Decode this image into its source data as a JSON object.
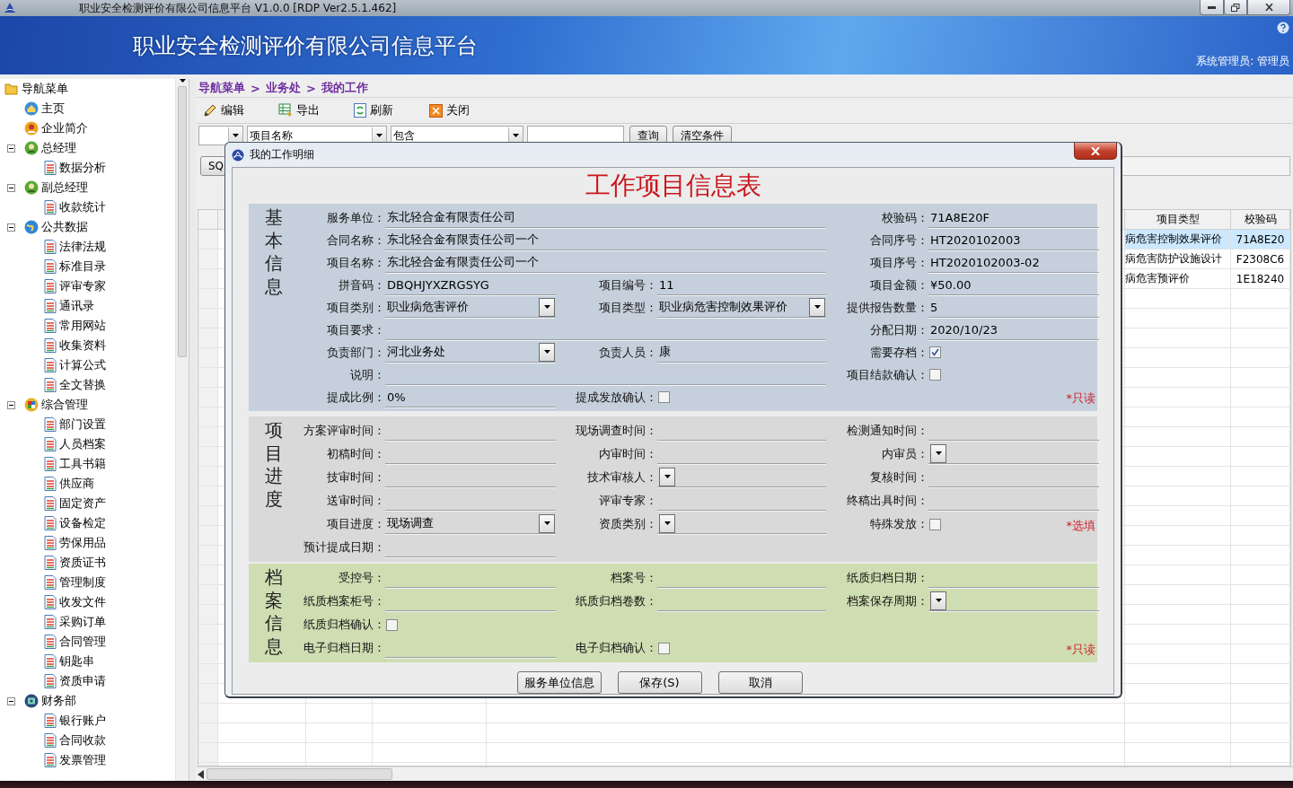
{
  "window": {
    "title": "职业安全检测评价有限公司信息平台 V1.0.0 [RDP Ver2.5.1.462]"
  },
  "banner": {
    "title": "职业安全检测评价有限公司信息平台",
    "user": "系统管理员: 管理员"
  },
  "sidebar": {
    "items": [
      {
        "label": "导航菜单",
        "kind": "folder",
        "children": [
          {
            "label": "主页",
            "kind": "home"
          },
          {
            "label": "企业简介",
            "kind": "contact"
          },
          {
            "label": "总经理",
            "kind": "manager",
            "expanded": true,
            "children": [
              {
                "label": "数据分析",
                "kind": "page"
              }
            ]
          },
          {
            "label": "副总经理",
            "kind": "manager",
            "expanded": true,
            "children": [
              {
                "label": "收款统计",
                "kind": "page"
              }
            ]
          },
          {
            "label": "公共数据",
            "kind": "globe",
            "expanded": true,
            "children": [
              {
                "label": "法律法规",
                "kind": "page"
              },
              {
                "label": "标准目录",
                "kind": "page"
              },
              {
                "label": "评审专家",
                "kind": "page"
              },
              {
                "label": "通讯录",
                "kind": "page"
              },
              {
                "label": "常用网站",
                "kind": "page"
              },
              {
                "label": "收集资料",
                "kind": "page"
              },
              {
                "label": "计算公式",
                "kind": "page"
              },
              {
                "label": "全文替换",
                "kind": "page"
              }
            ]
          },
          {
            "label": "综合管理",
            "kind": "admin",
            "expanded": true,
            "children": [
              {
                "label": "部门设置",
                "kind": "page"
              },
              {
                "label": "人员档案",
                "kind": "page"
              },
              {
                "label": "工具书籍",
                "kind": "page"
              },
              {
                "label": "供应商",
                "kind": "page"
              },
              {
                "label": "固定资产",
                "kind": "page"
              },
              {
                "label": "设备检定",
                "kind": "page"
              },
              {
                "label": "劳保用品",
                "kind": "page"
              },
              {
                "label": "资质证书",
                "kind": "page"
              },
              {
                "label": "管理制度",
                "kind": "page"
              },
              {
                "label": "收发文件",
                "kind": "page"
              },
              {
                "label": "采购订单",
                "kind": "page"
              },
              {
                "label": "合同管理",
                "kind": "page"
              },
              {
                "label": "钥匙串",
                "kind": "page"
              },
              {
                "label": "资质申请",
                "kind": "page"
              }
            ]
          },
          {
            "label": "财务部",
            "kind": "finance",
            "expanded": true,
            "children": [
              {
                "label": "银行账户",
                "kind": "page"
              },
              {
                "label": "合同收款",
                "kind": "page"
              },
              {
                "label": "发票管理",
                "kind": "page"
              }
            ]
          }
        ]
      }
    ]
  },
  "breadcrumb": {
    "items": [
      "导航菜单",
      "业务处",
      "我的工作"
    ],
    "separator": ">"
  },
  "toolbar": [
    {
      "label": "编辑",
      "kind": "edit"
    },
    {
      "label": "导出",
      "kind": "export"
    },
    {
      "label": "刷新",
      "kind": "refresh"
    },
    {
      "label": "关闭",
      "kind": "close"
    }
  ],
  "filter": {
    "field": "项目名称",
    "operator": "包含",
    "buttons": [
      "查询",
      "清空条件"
    ],
    "sql_button": "SQ"
  },
  "table": {
    "columns": [
      "项目类型",
      "校验码"
    ],
    "rows": [
      {
        "cells": [
          "病危害控制效果评价",
          "71A8E20"
        ],
        "selected": true
      },
      {
        "cells": [
          "病危害防护设施设计",
          "F2308C6"
        ],
        "selected": false
      },
      {
        "cells": [
          "病危害预评价",
          "1E18240"
        ],
        "selected": false
      }
    ]
  },
  "dialog": {
    "title": "我的工作明细",
    "heading": "工作项目信息表",
    "sections": [
      {
        "kind": "basic",
        "title": "基本信息",
        "rows": [
          {
            "fields": [
              {
                "label": "服务单位：",
                "kind": "text",
                "value": "东北轻合金有限责任公司",
                "wide": true
              },
              {
                "label": "校验码：",
                "kind": "text",
                "value": "71A8E20F"
              }
            ]
          },
          {
            "fields": [
              {
                "label": "合同名称：",
                "kind": "text",
                "value": "东北轻合金有限责任公司一个",
                "wide": true
              },
              {
                "label": "合同序号：",
                "kind": "text",
                "value": "HT2020102003"
              }
            ]
          },
          {
            "fields": [
              {
                "label": "项目名称：",
                "kind": "text",
                "value": "东北轻合金有限责任公司一个",
                "wide": true
              },
              {
                "label": "项目序号：",
                "kind": "text",
                "value": "HT2020102003-02"
              }
            ]
          },
          {
            "fields": [
              {
                "label": "拼音码：",
                "kind": "text",
                "value": "DBQHJYXZRGSYG"
              },
              {
                "label": "项目编号：",
                "kind": "text",
                "value": "11"
              },
              {
                "label": "项目金额：",
                "kind": "text",
                "value": "¥50.00"
              }
            ]
          },
          {
            "fields": [
              {
                "label": "项目类别：",
                "kind": "select",
                "value": "职业病危害评价"
              },
              {
                "label": "项目类型：",
                "kind": "select",
                "value": "职业病危害控制效果评价"
              },
              {
                "label": "提供报告数量：",
                "kind": "text",
                "value": "5"
              }
            ]
          },
          {
            "fields": [
              {
                "label": "项目要求：",
                "kind": "text",
                "wide": true
              },
              {
                "label": "分配日期：",
                "kind": "text",
                "value": "2020/10/23"
              }
            ]
          },
          {
            "fields": [
              {
                "label": "负责部门：",
                "kind": "select",
                "value": "河北业务处"
              },
              {
                "label": "负责人员：",
                "kind": "text",
                "value": "康"
              },
              {
                "label": "需要存档：",
                "kind": "checkbox",
                "checked": true
              }
            ]
          },
          {
            "fields": [
              {
                "label": "说明：",
                "kind": "text",
                "wide": true
              },
              {
                "label": "项目结款确认：",
                "kind": "checkbox",
                "checked": false
              }
            ]
          },
          {
            "fields": [
              {
                "label": "提成比例：",
                "kind": "text",
                "value": "0%"
              },
              {
                "label": "提成发放确认：",
                "kind": "checkbox",
                "checked": false
              }
            ],
            "note": "*只读"
          }
        ]
      },
      {
        "kind": "progress",
        "title": "项目进度",
        "rows": [
          {
            "fields": [
              {
                "label": "方案评审时间：",
                "kind": "text"
              },
              {
                "label": "现场调查时间：",
                "kind": "text"
              },
              {
                "label": "检测通知时间：",
                "kind": "text"
              }
            ]
          },
          {
            "fields": [
              {
                "label": "初稿时间：",
                "kind": "text"
              },
              {
                "label": "内审时间：",
                "kind": "text"
              },
              {
                "label": "内审员：",
                "kind": "select"
              }
            ]
          },
          {
            "fields": [
              {
                "label": "技审时间：",
                "kind": "text"
              },
              {
                "label": "技术审核人：",
                "kind": "select"
              },
              {
                "label": "复核时间：",
                "kind": "text"
              }
            ]
          },
          {
            "fields": [
              {
                "label": "送审时间：",
                "kind": "text"
              },
              {
                "label": "评审专家：",
                "kind": "text"
              },
              {
                "label": "终稿出具时间：",
                "kind": "text"
              }
            ]
          },
          {
            "fields": [
              {
                "label": "项目进度：",
                "kind": "select",
                "value": "现场调查"
              },
              {
                "label": "资质类别：",
                "kind": "select"
              },
              {
                "label": "特殊发放：",
                "kind": "checkbox",
                "checked": false
              }
            ],
            "note": "*选填"
          },
          {
            "fields": [
              {
                "label": "预计提成日期：",
                "kind": "text"
              }
            ]
          }
        ]
      },
      {
        "kind": "archive",
        "title": "档案信息",
        "rows": [
          {
            "fields": [
              {
                "label": "受控号：",
                "kind": "text"
              },
              {
                "label": "档案号：",
                "kind": "text"
              },
              {
                "label": "纸质归档日期：",
                "kind": "text"
              }
            ]
          },
          {
            "fields": [
              {
                "label": "纸质档案柜号：",
                "kind": "text"
              },
              {
                "label": "纸质归档卷数：",
                "kind": "text"
              },
              {
                "label": "档案保存周期：",
                "kind": "select"
              }
            ]
          },
          {
            "fields": [
              {
                "label": "纸质归档确认：",
                "kind": "checkbox",
                "checked": false
              }
            ]
          },
          {
            "fields": [
              {
                "label": "电子归档日期：",
                "kind": "text"
              },
              {
                "label": "电子归档确认：",
                "kind": "checkbox",
                "checked": false
              }
            ],
            "note": "*只读"
          }
        ]
      }
    ],
    "buttons": [
      "服务单位信息",
      "保存(S)",
      "取消"
    ]
  }
}
